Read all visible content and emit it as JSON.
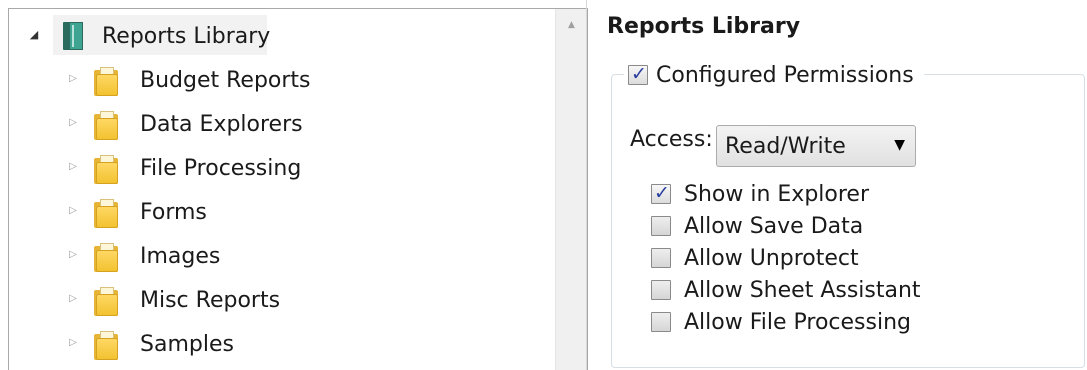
{
  "tree": {
    "root": {
      "label": "Reports Library",
      "expanded": true,
      "icon": "library-icon"
    },
    "folders": [
      {
        "label": "Budget Reports",
        "icon": "folder-icon"
      },
      {
        "label": "Data Explorers",
        "icon": "folder-icon"
      },
      {
        "label": "File Processing",
        "icon": "folder-icon"
      },
      {
        "label": "Forms",
        "icon": "folder-icon"
      },
      {
        "label": "Images",
        "icon": "folder-icon"
      },
      {
        "label": "Misc Reports",
        "icon": "folder-icon"
      },
      {
        "label": "Samples",
        "icon": "folder-icon"
      }
    ],
    "glyphs": {
      "expanded": "◢",
      "collapsed": "▷",
      "scroll_up": "▲"
    }
  },
  "details": {
    "title": "Reports Library",
    "configured_permissions": {
      "label": "Configured Permissions",
      "checked": true
    },
    "access": {
      "label": "Access:",
      "value": "Read/Write",
      "arrow": "▼"
    },
    "permissions": [
      {
        "label": "Show in Explorer",
        "checked": true
      },
      {
        "label": "Allow Save Data",
        "checked": false
      },
      {
        "label": "Allow Unprotect",
        "checked": false
      },
      {
        "label": "Allow Sheet Assistant",
        "checked": false
      },
      {
        "label": "Allow File Processing",
        "checked": false
      }
    ]
  },
  "colors": {
    "check_mark": "#2b3f9f",
    "folder": "#f2c12e",
    "library": "#3fa391"
  }
}
